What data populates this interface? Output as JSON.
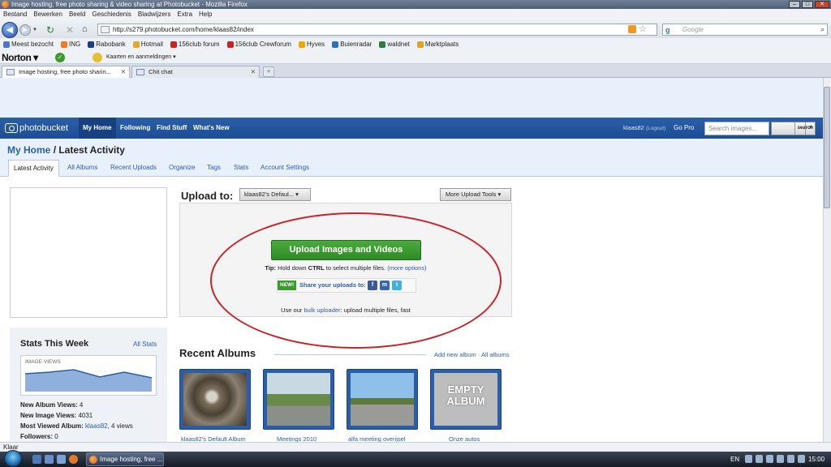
{
  "window": {
    "title": "Image hosting, free photo sharing & video sharing at Photobucket - Mozilla Firefox"
  },
  "menu": [
    "Bestand",
    "Bewerken",
    "Beeld",
    "Geschiedenis",
    "Bladwijzers",
    "Extra",
    "Help"
  ],
  "urlbar": {
    "url": "http://s279.photobucket.com/home/klaas82/index"
  },
  "search": {
    "placeholder": "Google"
  },
  "bookmarks": [
    {
      "label": "Meest bezocht",
      "color": "#4a78c8"
    },
    {
      "label": "ING",
      "color": "#f07b1c"
    },
    {
      "label": "Rabobank",
      "color": "#1b3e8c"
    },
    {
      "label": "Hotmail",
      "color": "#e8a72a"
    },
    {
      "label": "156club forum",
      "color": "#c22"
    },
    {
      "label": "156club Crewforum",
      "color": "#c22"
    },
    {
      "label": "Hyves",
      "color": "#f2a600"
    },
    {
      "label": "Buienradar",
      "color": "#2a6fd0"
    },
    {
      "label": "waldnet",
      "color": "#2f7d3a"
    },
    {
      "label": "Marktplaats",
      "color": "#e6a020"
    }
  ],
  "norton": {
    "brand": "Norton",
    "identity_label": "Kaarten en aanmeldingen"
  },
  "tabs": [
    {
      "label": "Image hosting, free photo sharin...",
      "active": true
    },
    {
      "label": "Chit chat",
      "active": false
    }
  ],
  "photobucket": {
    "logo": "photobucket",
    "nav": [
      "My Home",
      "Following",
      "Find Stuff",
      "What's New"
    ],
    "user": "klaas82",
    "logout": "(Logout)",
    "gopro": "Go Pro",
    "search_placeholder": "Search images...",
    "search_button": "search"
  },
  "page": {
    "title_home": "My Home",
    "title_rest": "/ Latest Activity",
    "subtabs": [
      "Latest Activity",
      "All Albums",
      "Recent Uploads",
      "Organize",
      "Tags",
      "Stats",
      "Account Settings"
    ]
  },
  "upload": {
    "label": "Upload to:",
    "album_select": "klaas82's Defaul...",
    "more_tools": "More Upload Tools",
    "button": "Upload Images and Videos",
    "tip_prefix": "Tip:",
    "tip_text": "Hold down",
    "tip_key": "CTRL",
    "tip_rest": "to select multiple files.",
    "more_options": "(more options)",
    "new_badge": "NEW!",
    "share_text": "Share your uploads to:",
    "bulk_prefix": "Use our",
    "bulk_link": "bulk uploader",
    "bulk_rest": ": upload multiple files, fast"
  },
  "stats": {
    "title": "Stats This Week",
    "all_link": "All Stats",
    "graph_label": "IMAGE VIEWS",
    "album_views_label": "New Album Views:",
    "album_views": "4",
    "image_views_label": "New Image Views:",
    "image_views": "4031",
    "most_viewed_label": "Most Viewed Album:",
    "most_viewed_album": "klaas82",
    "most_viewed_views": ", 4 views",
    "followers_label": "Followers:",
    "followers": "0"
  },
  "albums": {
    "title": "Recent Albums",
    "add_link": "Add new album",
    "sep": "·",
    "all_link": "All albums",
    "items": [
      {
        "name": "klaas82's Default Album"
      },
      {
        "name": "Meetings 2010"
      },
      {
        "name": "alfa meeting overijsel"
      },
      {
        "name": "Onze autos",
        "empty_text": "EMPTY ALBUM"
      }
    ]
  },
  "statusbar": {
    "text": "Klaar"
  },
  "taskbar": {
    "item": "Image hosting, free ...",
    "lang": "EN",
    "clock": "15:00"
  }
}
